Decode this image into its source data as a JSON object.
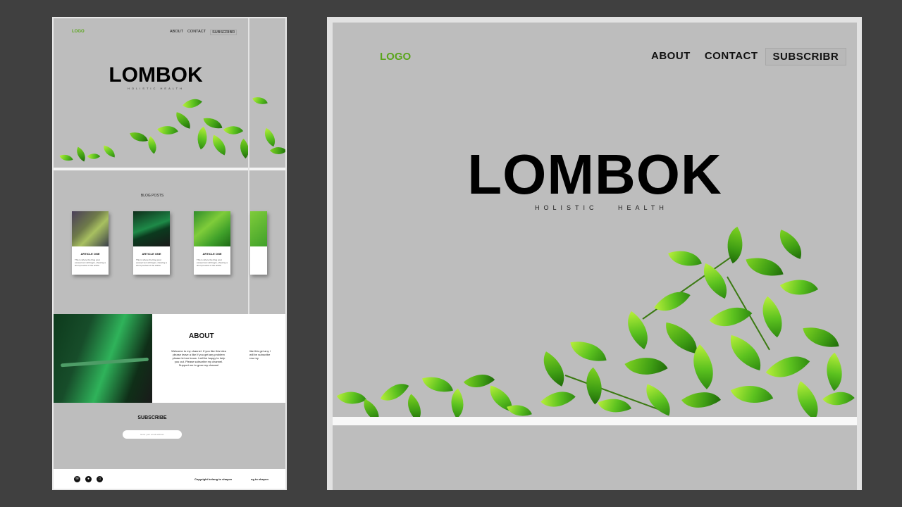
{
  "left_mockup": {
    "nav": {
      "logo": "LOGO",
      "links": [
        "ABOUT",
        "CONTACT",
        "SUBSCRIBR"
      ]
    },
    "hero": {
      "title": "LOMBOK",
      "tagline": "HOLISTIC   HEALTH"
    },
    "blog": {
      "heading": "BLOG POSTS",
      "cards": [
        {
          "title": "ARTICLE ONE",
          "body": "This is where the blog post excerpt text will begin, showing a short preview of the article"
        },
        {
          "title": "ARTICLE ONE",
          "body": "This is where the blog post excerpt text will begin, showing a short preview of the article"
        },
        {
          "title": "ARTICLE ONE",
          "body": "This is where the blog post excerpt text will begin, showing a short preview of the article"
        }
      ]
    },
    "about": {
      "heading": "ABOUT",
      "body": "Welcome to my channel. If you like this idea please leave a like If you get any problem please let me know. I will be happy to help you out. Please subscribe my channel. Support me to grow my channel",
      "body_overflow": "like this get any I will be subscribe row my"
    },
    "subscribe": {
      "heading": "SUBSCRIBE",
      "placeholder": "Enter your email address"
    },
    "footer": {
      "copyright": "Copyright belong to shayon",
      "copyright_overflow": "ng to shayon",
      "icons": [
        "mail-icon",
        "user-icon",
        "phone-icon"
      ]
    }
  },
  "right_mockup": {
    "nav": {
      "logo": "LOGO",
      "links": [
        "ABOUT",
        "CONTACT",
        "SUBSCRIBR"
      ]
    },
    "hero": {
      "title": "LOMBOK",
      "tagline": "HOLISTIC   HEALTH"
    }
  },
  "colors": {
    "background": "#404040",
    "panel": "#bdbdbd",
    "logo": "#5aa51c",
    "leaf": "#5cc21f"
  }
}
